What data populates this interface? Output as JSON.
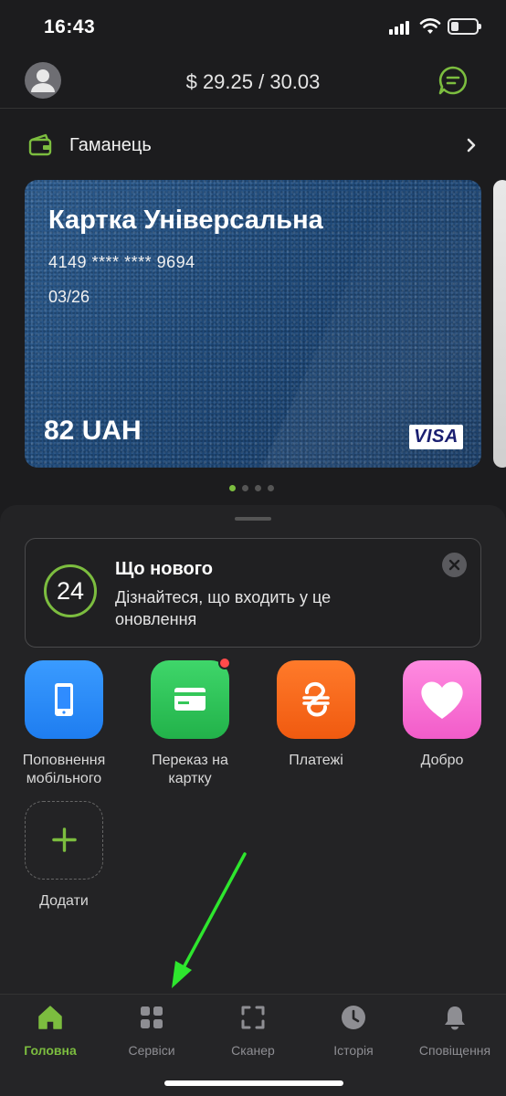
{
  "status_bar": {
    "time": "16:43",
    "signal_icon": "cellular-signal-icon",
    "wifi_icon": "wifi-icon",
    "battery_icon": "battery-low-icon"
  },
  "header": {
    "avatar_icon": "user-avatar-icon",
    "exchange_rate": "$ 29.25 / 30.03",
    "chat_icon": "chat-bubble-icon"
  },
  "wallet": {
    "label": "Гаманець",
    "icon": "wallet-icon",
    "chevron_icon": "chevron-right-icon",
    "cards": [
      {
        "title": "Картка Універсальна",
        "number": "4149 **** **** 9694",
        "expiry": "03/26",
        "balance": "82 UAH",
        "brand": "VISA"
      }
    ],
    "pager_count": 4,
    "pager_active": 0
  },
  "news": {
    "badge": "24",
    "title": "Що нового",
    "text": "Дізнайтеся, що входить у це оновлення",
    "close_icon": "close-icon"
  },
  "services": [
    {
      "label": "Поповнення мобільного",
      "icon": "smartphone-icon",
      "color": "#2f8cff"
    },
    {
      "label": "Переказ на картку",
      "icon": "credit-card-icon",
      "color": "#34c759",
      "notification": true
    },
    {
      "label": "Платежі",
      "icon": "hryvnia-icon",
      "color": "#ff6a1f"
    },
    {
      "label": "Добро",
      "icon": "heart-icon",
      "color": "#f86fd6"
    },
    {
      "label": "Додати",
      "icon": "plus-icon",
      "color": "#7cbd3f"
    }
  ],
  "tabbar": {
    "items": [
      {
        "label": "Головна",
        "icon": "home-icon",
        "active": true
      },
      {
        "label": "Сервіси",
        "icon": "grid-icon",
        "active": false
      },
      {
        "label": "Сканер",
        "icon": "scanner-icon",
        "active": false
      },
      {
        "label": "Історія",
        "icon": "clock-icon",
        "active": false
      },
      {
        "label": "Сповіщення",
        "icon": "bell-icon",
        "active": false
      }
    ]
  },
  "colors": {
    "accent": "#7cbd3f",
    "background": "#1c1c1e",
    "annotation_arrow": "#2ee62e"
  }
}
